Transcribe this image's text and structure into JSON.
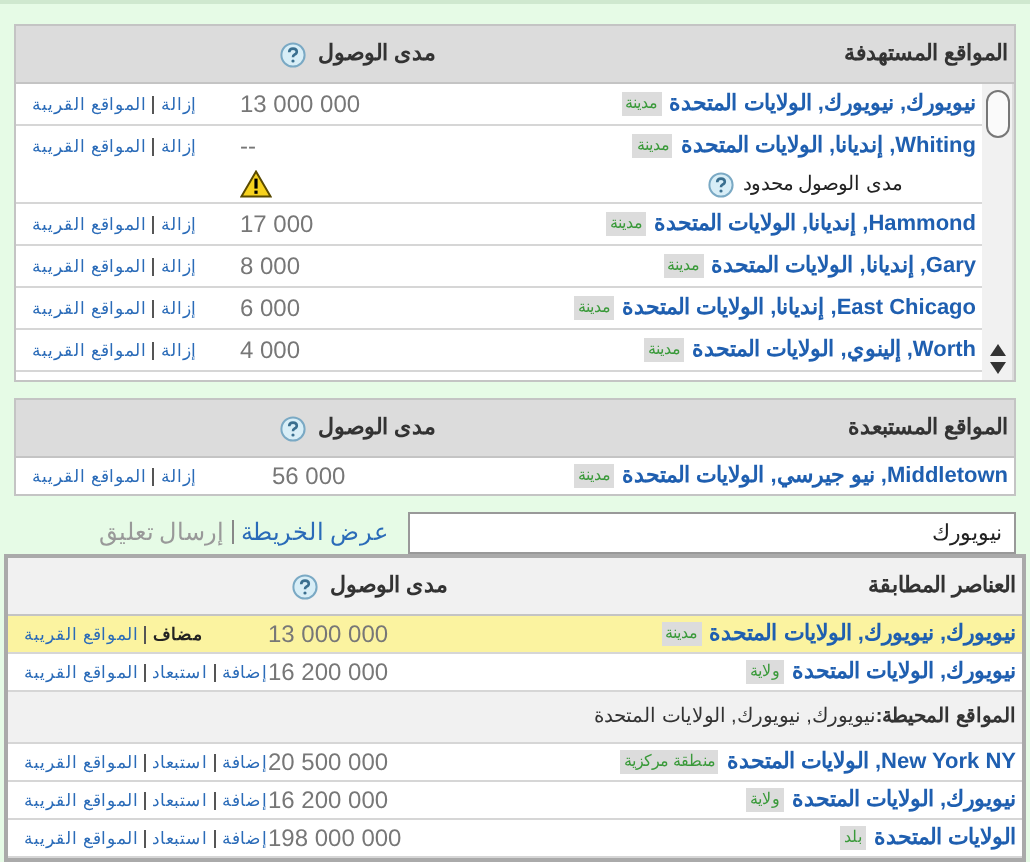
{
  "targeted": {
    "title": "المواقع المستهدفة",
    "reach_header": "مدى الوصول",
    "rows": [
      {
        "name": "نيويورك, نيويورك, الولايات المتحدة",
        "tag": "مدينة",
        "reach": "13 000 000",
        "actions": [
          "إزالة",
          "المواقع القريبة"
        ]
      },
      {
        "name": "Whiting, إنديانا, الولايات المتحدة",
        "tag": "مدينة",
        "reach": "--",
        "actions": [
          "إزالة",
          "المواقع القريبة"
        ],
        "note": "مدى الوصول محدود"
      },
      {
        "name": "Hammond, إنديانا, الولايات المتحدة",
        "tag": "مدينة",
        "reach": "17 000",
        "actions": [
          "إزالة",
          "المواقع القريبة"
        ]
      },
      {
        "name": "Gary, إنديانا, الولايات المتحدة",
        "tag": "مدينة",
        "reach": "8 000",
        "actions": [
          "إزالة",
          "المواقع القريبة"
        ]
      },
      {
        "name": "East Chicago, إنديانا, الولايات المتحدة",
        "tag": "مدينة",
        "reach": "6 000",
        "actions": [
          "إزالة",
          "المواقع القريبة"
        ]
      },
      {
        "name": "Worth, إلينوي, الولايات المتحدة",
        "tag": "مدينة",
        "reach": "4 000",
        "actions": [
          "إزالة",
          "المواقع القريبة"
        ]
      }
    ]
  },
  "excluded": {
    "title": "المواقع المستبعدة",
    "reach_header": "مدى الوصول",
    "rows": [
      {
        "name": "Middletown, نيو جيرسي, الولايات المتحدة",
        "tag": "مدينة",
        "reach": "56 000",
        "actions": [
          "إزالة",
          "المواقع القريبة"
        ]
      }
    ]
  },
  "search": {
    "value": "نيويورك",
    "links": [
      {
        "label": "عرض الخريطة",
        "disabled": false
      },
      {
        "label": "إرسال تعليق",
        "disabled": true
      }
    ]
  },
  "results": {
    "title": "العناصر المطابقة",
    "reach_header": "مدى الوصول",
    "rows": [
      {
        "name": "نيويورك, نيويورك, الولايات المتحدة",
        "tag": "مدينة",
        "reach": "13 000 000",
        "highlighted": true,
        "actions": [
          {
            "label": "مضاف",
            "kind": "status"
          },
          {
            "label": "المواقع القريبة",
            "kind": "link"
          }
        ]
      },
      {
        "name": "نيويورك, الولايات المتحدة",
        "tag": "ولاية",
        "reach": "16 200 000",
        "highlighted": false,
        "actions": [
          {
            "label": "إضافة",
            "kind": "link"
          },
          {
            "label": "استبعاد",
            "kind": "link"
          },
          {
            "label": "المواقع القريبة",
            "kind": "link"
          }
        ]
      }
    ],
    "surrounding_header": "**المواقع المحيطة:**نيويورك, نيويورك, الولايات المتحدة",
    "surrounding_rows": [
      {
        "name": "New York NY, الولايات المتحدة",
        "tag": "منطقة مركزية",
        "reach": "20 500 000",
        "highlighted": false,
        "actions": [
          {
            "label": "إضافة",
            "kind": "link"
          },
          {
            "label": "استبعاد",
            "kind": "link"
          },
          {
            "label": "المواقع القريبة",
            "kind": "link"
          }
        ]
      },
      {
        "name": "نيويورك, الولايات المتحدة",
        "tag": "ولاية",
        "reach": "16 200 000",
        "highlighted": false,
        "actions": [
          {
            "label": "إضافة",
            "kind": "link"
          },
          {
            "label": "استبعاد",
            "kind": "link"
          },
          {
            "label": "المواقع القريبة",
            "kind": "link"
          }
        ]
      },
      {
        "name": "الولايات المتحدة",
        "tag": "بلد",
        "reach": "198 000 000",
        "highlighted": false,
        "actions": [
          {
            "label": "إضافة",
            "kind": "link"
          },
          {
            "label": "استبعاد",
            "kind": "link"
          },
          {
            "label": "المواقع القريبة",
            "kind": "link"
          }
        ]
      }
    ]
  }
}
